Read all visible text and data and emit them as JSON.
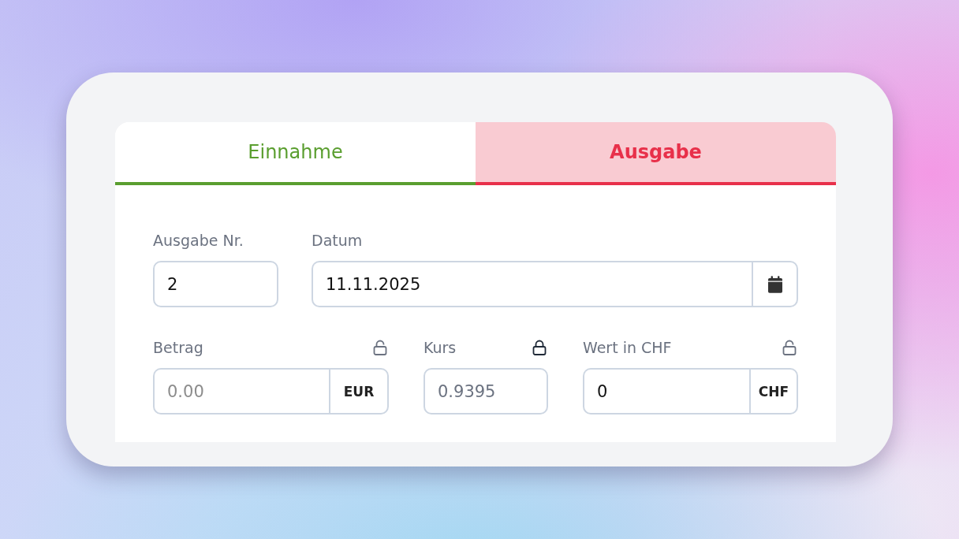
{
  "tabs": [
    {
      "label": "Einnahme",
      "selected": false,
      "color": "#5a9e2f"
    },
    {
      "label": "Ausgabe",
      "selected": true,
      "color": "#e8304a"
    }
  ],
  "form": {
    "rows": [
      {
        "fields": [
          {
            "kind": "text",
            "label": "Ausgabe Nr.",
            "value": "2"
          },
          {
            "kind": "date",
            "label": "Datum",
            "value": "11.11.2025"
          }
        ]
      },
      {
        "fields": [
          {
            "kind": "currency",
            "label": "Betrag",
            "placeholder": "0.00",
            "unit": "EUR",
            "locked": false
          },
          {
            "kind": "text",
            "label": "Kurs",
            "value": "0.9395",
            "locked": true
          },
          {
            "kind": "currency",
            "label": "Wert in CHF",
            "value": "0",
            "unit": "CHF",
            "locked": false
          }
        ]
      }
    ]
  }
}
